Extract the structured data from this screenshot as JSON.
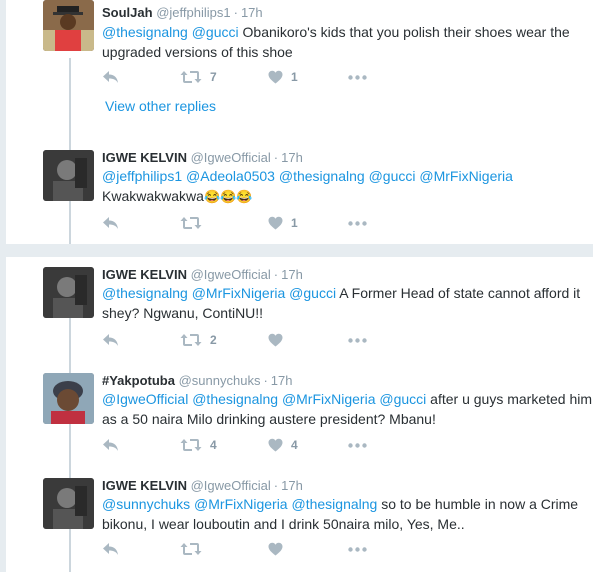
{
  "tweets": [
    {
      "name": "SoulJah",
      "handle": "@jeffphilips1",
      "time": "17h",
      "lines": [
        [
          {
            "t": "@thesignalng",
            "m": true
          },
          {
            "t": " "
          },
          {
            "t": "@gucci",
            "m": true
          },
          {
            "t": " Obanikoro's kids that you polish their shoes wear the"
          }
        ],
        [
          {
            "t": "upgraded versions of this shoe"
          }
        ]
      ],
      "retweets": "7",
      "likes": "1"
    },
    {
      "name": "IGWE KELVIN",
      "handle": "@IgweOfficial",
      "time": "17h",
      "lines": [
        [
          {
            "t": "@jeffphilips1",
            "m": true
          },
          {
            "t": " "
          },
          {
            "t": "@Adeola0503",
            "m": true
          },
          {
            "t": " "
          },
          {
            "t": "@thesignalng",
            "m": true
          },
          {
            "t": " "
          },
          {
            "t": "@gucci",
            "m": true
          },
          {
            "t": " "
          },
          {
            "t": "@MrFixNigeria",
            "m": true
          }
        ],
        [
          {
            "t": "Kwakwakwakwa"
          },
          {
            "t": "😂😂😂",
            "e": true
          }
        ]
      ],
      "retweets": "",
      "likes": "1"
    },
    {
      "name": "IGWE KELVIN",
      "handle": "@IgweOfficial",
      "time": "17h",
      "lines": [
        [
          {
            "t": "@thesignalng",
            "m": true
          },
          {
            "t": " "
          },
          {
            "t": "@MrFixNigeria",
            "m": true
          },
          {
            "t": " "
          },
          {
            "t": "@gucci",
            "m": true
          },
          {
            "t": " A Former Head of state cannot afford it"
          }
        ],
        [
          {
            "t": "shey? Ngwanu, ContiNU!!"
          }
        ]
      ],
      "retweets": "2",
      "likes": ""
    },
    {
      "name": "#Yakpotuba",
      "handle": "@sunnychuks",
      "time": "17h",
      "lines": [
        [
          {
            "t": "@IgweOfficial",
            "m": true
          },
          {
            "t": " "
          },
          {
            "t": "@thesignalng",
            "m": true
          },
          {
            "t": " "
          },
          {
            "t": "@MrFixNigeria",
            "m": true
          },
          {
            "t": " "
          },
          {
            "t": "@gucci",
            "m": true
          },
          {
            "t": " after u guys marketed him"
          }
        ],
        [
          {
            "t": "as a 50 naira Milo drinking austere president? Mbanu!"
          }
        ]
      ],
      "retweets": "4",
      "likes": "4"
    },
    {
      "name": "IGWE KELVIN",
      "handle": "@IgweOfficial",
      "time": "17h",
      "lines": [
        [
          {
            "t": "@sunnychuks",
            "m": true
          },
          {
            "t": " "
          },
          {
            "t": "@MrFixNigeria",
            "m": true
          },
          {
            "t": " "
          },
          {
            "t": "@thesignalng",
            "m": true
          },
          {
            "t": " so to be humble in now a Crime"
          }
        ],
        [
          {
            "t": "bikonu, I wear louboutin and I drink 50naira milo, Yes, Me.."
          }
        ]
      ],
      "retweets": "",
      "likes": ""
    }
  ],
  "view_other_replies": "View other replies",
  "colors": {
    "mention": "#1b95e0",
    "muted": "#8899a6",
    "background": "#e6ecf0",
    "thread_line": "#ccd6dd"
  },
  "icons": {
    "reply": "reply-arrow-icon",
    "retweet": "retweet-icon",
    "like": "heart-icon",
    "more": "more-dots-icon"
  }
}
